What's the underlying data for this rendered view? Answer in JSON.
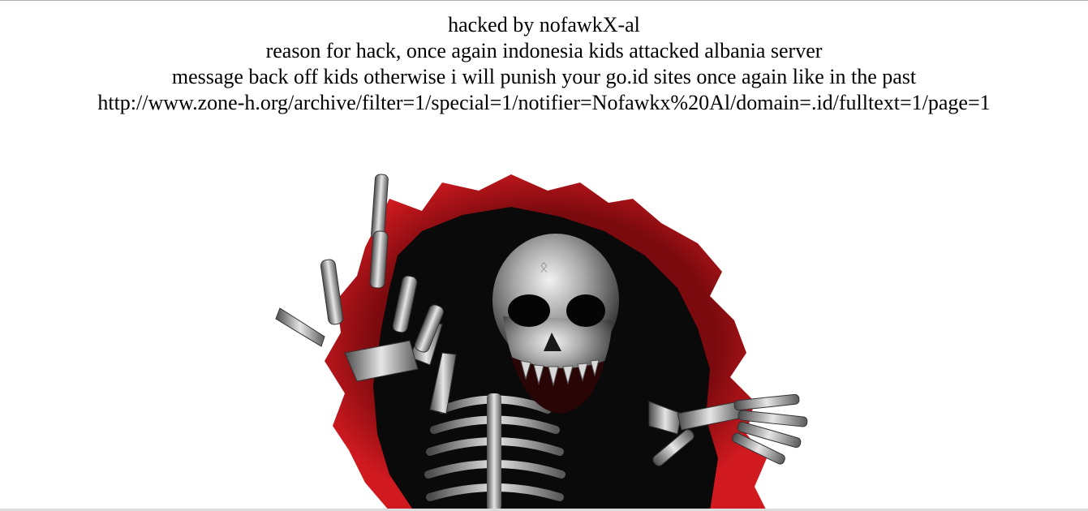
{
  "page": {
    "lines": [
      "hacked by nofawkX-al",
      "reason for hack, once again indonesia kids attacked albania server",
      "message back off kids otherwise i will punish your go.id sites once again like in the past",
      "http://www.zone-h.org/archive/filter=1/special=1/notifier=Nofawkx%20Al/domain=.id/fulltext=1/page=1"
    ]
  },
  "image": {
    "subject": "skeleton-breaking-through-red-torn-hole",
    "colors": {
      "tear_red": "#c4161c",
      "hole_black": "#0a0a0a",
      "bone_silver": "#b8b8b8",
      "bone_shadow": "#5a5a5a"
    }
  }
}
